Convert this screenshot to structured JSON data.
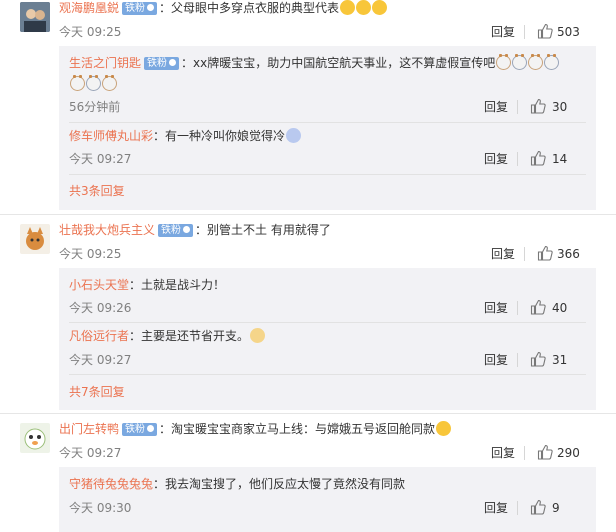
{
  "actions": {
    "reply": "回复"
  },
  "badge_label": "铁粉",
  "threads": [
    {
      "user": "观海鹏凰鋭",
      "text": "：父母眼中多穿点衣服的典型代表",
      "time": "今天 09:25",
      "likes": "503",
      "replies": [
        {
          "user": "生活之门钥匙",
          "text": "：xx牌暖宝宝，助力中国航空航天事业，这不算虚假宣传吧",
          "time": "56分钟前",
          "likes": "30"
        },
        {
          "user": "修车师傅丸山彩",
          "text": "：有一种冷叫你娘觉得冷",
          "time": "今天 09:27",
          "likes": "14"
        }
      ],
      "more": "共3条回复"
    },
    {
      "user": "壮哉我大炮兵主义",
      "text": "：别管土不土 有用就得了",
      "time": "今天 09:25",
      "likes": "366",
      "replies": [
        {
          "user": "小石头天堂",
          "text": "：土就是战斗力！",
          "time": "今天 09:26",
          "likes": "40"
        },
        {
          "user": "凡俗远行者",
          "text": "：主要是还节省开支。",
          "time": "今天 09:27",
          "likes": "31"
        }
      ],
      "more": "共7条回复"
    },
    {
      "user": "出门左转鸭",
      "text": "：淘宝暖宝宝商家立马上线：与嫦娥五号返回舱同款",
      "time": "今天 09:27",
      "likes": "290",
      "replies": [
        {
          "user": "守猪待兔兔兔兔",
          "text": "：我去淘宝搜了，他们反应太慢了竟然没有同款",
          "time": "今天 09:30",
          "likes": "9"
        }
      ]
    }
  ],
  "colors": {
    "username": "#eb7350",
    "badge": "#7aa8e0",
    "time": "#808080",
    "reply_bg": "#f2f2f5"
  },
  "icons": [
    "like-icon",
    "emoji-laugh-icon",
    "emoji-cat-icon",
    "emoji-shy-icon",
    "emoji-cold-icon",
    "vip-icon"
  ]
}
